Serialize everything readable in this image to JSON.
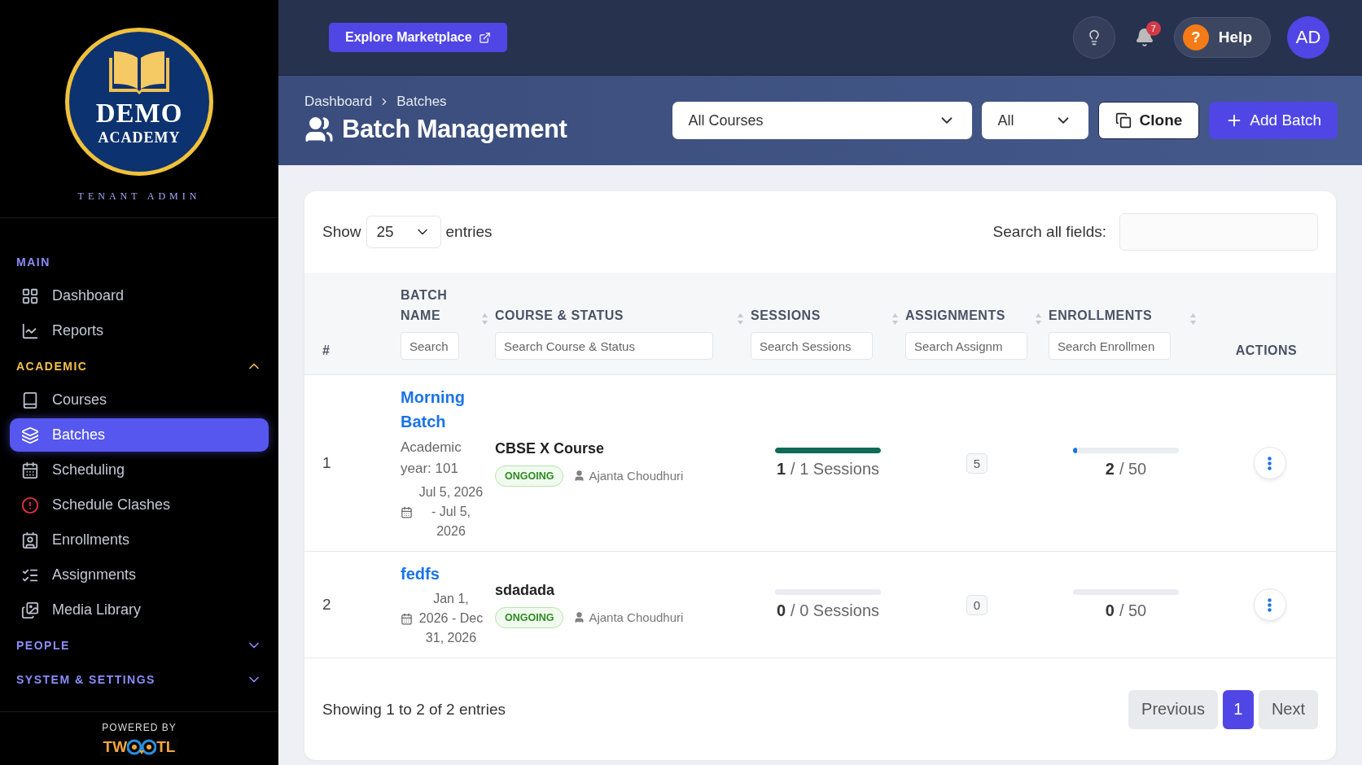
{
  "sidebar": {
    "logo": {
      "line1": "DEMO",
      "line2": "ACADEMY",
      "subtitle": "TENANT ADMIN"
    },
    "sections": [
      {
        "title": "MAIN",
        "items": [
          {
            "label": "Dashboard",
            "selected": false
          },
          {
            "label": "Reports",
            "selected": false
          }
        ]
      },
      {
        "title": "ACADEMIC",
        "expanded": true,
        "items": [
          {
            "label": "Courses",
            "selected": false
          },
          {
            "label": "Batches",
            "selected": true
          },
          {
            "label": "Scheduling",
            "selected": false
          },
          {
            "label": "Schedule Clashes",
            "selected": false
          },
          {
            "label": "Enrollments",
            "selected": false
          },
          {
            "label": "Assignments",
            "selected": false
          },
          {
            "label": "Media Library",
            "selected": false
          }
        ]
      },
      {
        "title": "PEOPLE",
        "expanded": false
      },
      {
        "title": "SYSTEM & SETTINGS",
        "expanded": false
      }
    ],
    "powered_by": "POWERED BY",
    "brand_left": "TW",
    "brand_right": "TL"
  },
  "topbar": {
    "marketplace_button": "Explore Marketplace",
    "notification_count": "7",
    "help_glyph": "?",
    "help_label": "Help",
    "avatar": "AD"
  },
  "header": {
    "breadcrumb": [
      "Dashboard",
      "Batches"
    ],
    "title": "Batch Management",
    "filters": [
      "All Courses",
      "All"
    ],
    "clone_button": "Clone",
    "add_button": "Add Batch"
  },
  "table": {
    "show_label": "Show",
    "page_size": "25",
    "entries_label": "entries",
    "search_label": "Search all fields:",
    "columns": [
      {
        "label": "#"
      },
      {
        "label": "BATCH NAME",
        "placeholder": "Search"
      },
      {
        "label": "COURSE & STATUS",
        "placeholder": "Search Course & Status"
      },
      {
        "label": "SESSIONS",
        "placeholder": "Search Sessions"
      },
      {
        "label": "ASSIGNMENTS",
        "placeholder": "Search Assignm"
      },
      {
        "label": "ENROLLMENTS",
        "placeholder": "Search Enrollmen"
      },
      {
        "label": "ACTIONS"
      }
    ],
    "rows": [
      {
        "index": "1",
        "name": "Morning Batch",
        "academic_year": "Academic year: 101",
        "dates": "Jul 5, 2026 - Jul 5, 2026",
        "course": "CBSE X Course",
        "status": "ONGOING",
        "instructor": "Ajanta Choudhuri",
        "sessions": {
          "done": "1",
          "total": "/ 1 Sessions",
          "level": 1
        },
        "assignments": "5",
        "enrollment": {
          "done": "2",
          "total": "/ 50",
          "level": 0.04
        }
      },
      {
        "index": "2",
        "name": "fedfs",
        "dates": "Jan 1, 2026 - Dec 31, 2026",
        "course": "sdadada",
        "status": "ONGOING",
        "instructor": "Ajanta Choudhuri",
        "sessions": {
          "done": "0",
          "total": "/ 0 Sessions",
          "level": 0
        },
        "assignments": "0",
        "enrollment": {
          "done": "0",
          "total": "/ 50",
          "level": 0
        }
      }
    ],
    "summary": "Showing 1 to 2 of 2 entries",
    "pagination": [
      {
        "label": "Previous",
        "selected": false
      },
      {
        "label": "1",
        "selected": true
      },
      {
        "label": "Next",
        "selected": false
      }
    ]
  }
}
